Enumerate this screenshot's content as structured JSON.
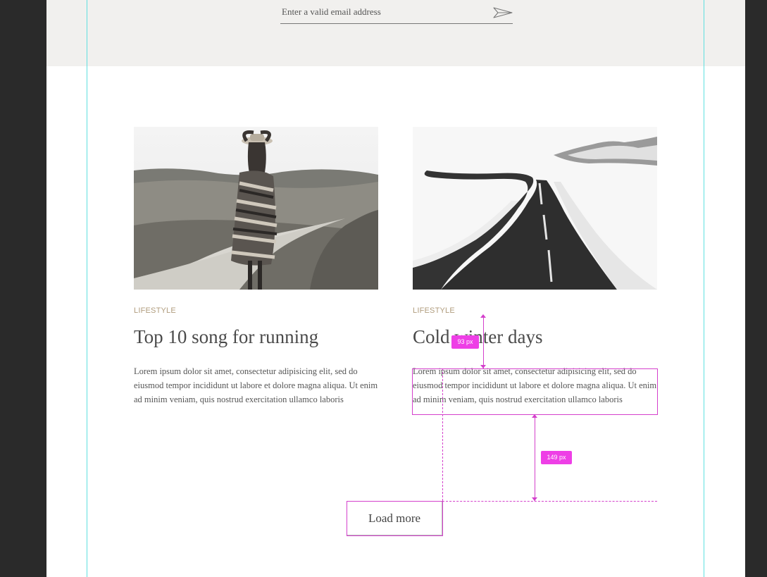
{
  "newsletter": {
    "email_placeholder": "Enter a valid email address",
    "send_icon": "paper-plane-icon"
  },
  "posts": [
    {
      "category": "LIFESTYLE",
      "title": "Top 10 song for running",
      "excerpt": "Lorem ipsum dolor sit amet, consectetur adipisicing elit, sed do eiusmod tempor incididunt ut labore et dolore magna aliqua. Ut enim ad minim veniam, quis nostrud exercitation ullamco laboris"
    },
    {
      "category": "LIFESTYLE",
      "title": "Cold winter days",
      "excerpt": "Lorem ipsum dolor sit amet, consectetur adipisicing elit, sed do eiusmod tempor incididunt ut labore et dolore magna aliqua. Ut enim ad minim veniam, quis nostrud exercitation ullamco laboris"
    }
  ],
  "load_more": {
    "label": "Load more"
  },
  "spec_overlay": {
    "title_to_text": "93 px",
    "text_to_button": "149 px",
    "color": "#ee3fe6"
  },
  "colors": {
    "canvas": "#2a2a2a",
    "newsletter_bg": "#f1f0ee",
    "category": "#b09c7d",
    "guide": "#5fe0e0"
  }
}
